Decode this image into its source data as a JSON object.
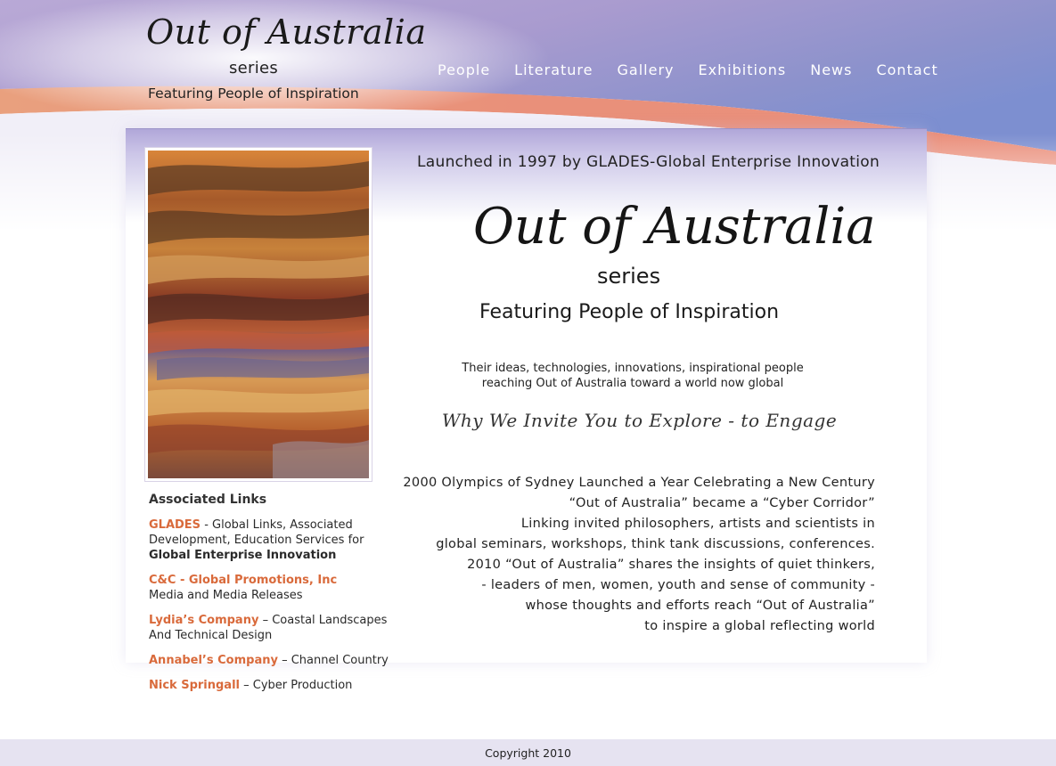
{
  "header": {
    "logo": {
      "script": "Out of Australia",
      "series": "series",
      "tagline": "Featuring People of Inspiration"
    },
    "nav": [
      "People",
      "Literature",
      "Gallery",
      "Exhibitions",
      "News",
      "Contact"
    ]
  },
  "sidebar": {
    "links_heading": "Associated Links",
    "links": [
      {
        "name": "GLADES",
        "text": " - Global Links, Associated Development, Education Services for ",
        "strong": "Global Enterprise Innovation"
      },
      {
        "name": "C&C - Global Promotions, Inc",
        "text": "Media and Media Releases"
      },
      {
        "name": "Lydia’s Company",
        "text": " – Coastal Landscapes And Technical Design"
      },
      {
        "name": "Annabel’s Company",
        "text": " – Channel Country"
      },
      {
        "name": "Nick Springall",
        "text": " – Cyber Production"
      }
    ]
  },
  "main": {
    "launched": "Launched in 1997 by GLADES-Global Enterprise Innovation",
    "logo": {
      "script": "Out of Australia",
      "series": "series",
      "tagline": "Featuring People of Inspiration"
    },
    "ideas_lines": [
      "Their ideas, technologies, innovations, inspirational people",
      "reaching Out of Australia toward a world now global"
    ],
    "why": "Why We Invite You to Explore - to Engage",
    "story_lines": [
      "2000 Olympics of Sydney Launched a Year Celebrating a New Century",
      "“Out of Australia” became a “Cyber Corridor”",
      "Linking invited philosophers, artists and scientists in",
      "global seminars, workshops, think tank discussions, conferences.",
      "2010 “Out of Australia” shares the insights of quiet thinkers,",
      "- leaders of men, women, youth and sense of community -",
      "whose thoughts and efforts reach “Out of Australia”",
      "to inspire a global reflecting world"
    ]
  },
  "footer": {
    "copyright": "Copyright 2010"
  },
  "colors": {
    "link_accent": "#d96a3b",
    "sky_purple": "#8c88c6",
    "sky_orange": "#e8907a",
    "panel_top": "#b0a7d9",
    "footer_bg": "#e6e3f1"
  }
}
